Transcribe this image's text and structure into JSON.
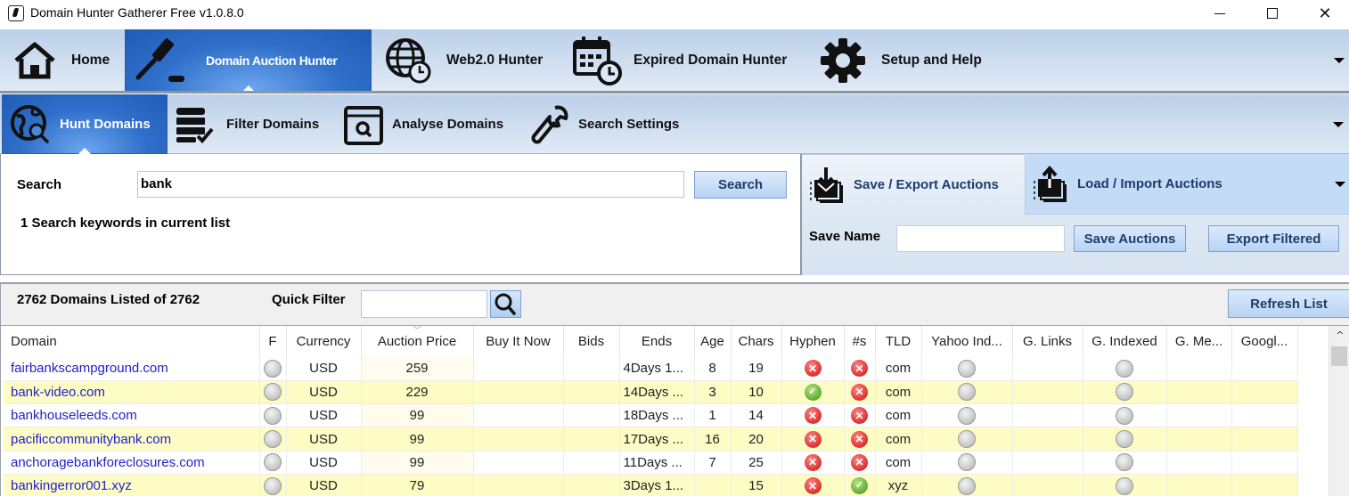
{
  "window": {
    "title": "Domain Hunter Gatherer Free v1.0.8.0",
    "controls": {
      "minimize": "—",
      "maximize": "☐",
      "close": "✕"
    }
  },
  "main_nav": {
    "items": [
      {
        "label": "Home",
        "icon": "home-icon",
        "active": false
      },
      {
        "label": "Domain Auction Hunter",
        "icon": "gavel-icon",
        "active": true
      },
      {
        "label": "Web2.0 Hunter",
        "icon": "globe-clock-icon",
        "active": false
      },
      {
        "label": "Expired Domain Hunter",
        "icon": "calendar-clock-icon",
        "active": false
      },
      {
        "label": "Setup and Help",
        "icon": "gear-icon",
        "active": false
      }
    ]
  },
  "sub_nav": {
    "items": [
      {
        "label": "Hunt Domains",
        "icon": "globe-search-icon",
        "active": true
      },
      {
        "label": "Filter Domains",
        "icon": "database-check-icon",
        "active": false
      },
      {
        "label": "Analyse Domains",
        "icon": "browser-search-icon",
        "active": false
      },
      {
        "label": "Search Settings",
        "icon": "wrench-icon",
        "active": false
      }
    ]
  },
  "search_panel": {
    "search_label": "Search",
    "search_value": "bank",
    "search_button": "Search",
    "keywords_status": "1 Search keywords in current list"
  },
  "export_panel": {
    "tabs": [
      {
        "label": "Save / Export Auctions",
        "icon": "download-stack-icon",
        "active": true
      },
      {
        "label": "Load / Import Auctions",
        "icon": "upload-stack-icon",
        "active": false
      }
    ],
    "save_name_label": "Save Name",
    "save_name_value": "",
    "save_button": "Save Auctions",
    "export_button": "Export Filtered"
  },
  "grid_toolbar": {
    "count_text": "2762 Domains Listed of 2762",
    "quick_filter_label": "Quick Filter",
    "quick_filter_value": "",
    "refresh_button": "Refresh List"
  },
  "table": {
    "sorted_column": "Auction Price",
    "columns": [
      "Domain",
      "F",
      "Currency",
      "Auction Price",
      "Buy It Now",
      "Bids",
      "Ends",
      "Age",
      "Chars",
      "Hyphen",
      "#s",
      "TLD",
      "Yahoo Ind...",
      "G. Links",
      "G. Indexed",
      "G. Me...",
      "Googl..."
    ],
    "rows": [
      {
        "domain": "fairbankscampground.com",
        "f": "unknown",
        "currency": "USD",
        "auction_price": "259",
        "buy_it_now": "",
        "bids": "",
        "ends": "4Days 1...",
        "age": "8",
        "chars": "19",
        "hyphen": "no",
        "numbers": "no",
        "tld": "com",
        "yahoo_indexed": "unknown",
        "g_links": "",
        "g_indexed": "unknown",
        "g_me": "",
        "googl": ""
      },
      {
        "domain": "bank-video.com",
        "f": "unknown",
        "currency": "USD",
        "auction_price": "229",
        "buy_it_now": "",
        "bids": "",
        "ends": "14Days ...",
        "age": "3",
        "chars": "10",
        "hyphen": "yes",
        "numbers": "no",
        "tld": "com",
        "yahoo_indexed": "unknown",
        "g_links": "",
        "g_indexed": "unknown",
        "g_me": "",
        "googl": ""
      },
      {
        "domain": "bankhouseleeds.com",
        "f": "unknown",
        "currency": "USD",
        "auction_price": "99",
        "buy_it_now": "",
        "bids": "",
        "ends": "18Days ...",
        "age": "1",
        "chars": "14",
        "hyphen": "no",
        "numbers": "no",
        "tld": "com",
        "yahoo_indexed": "unknown",
        "g_links": "",
        "g_indexed": "unknown",
        "g_me": "",
        "googl": ""
      },
      {
        "domain": "pacificcommunitybank.com",
        "f": "unknown",
        "currency": "USD",
        "auction_price": "99",
        "buy_it_now": "",
        "bids": "",
        "ends": "17Days ...",
        "age": "16",
        "chars": "20",
        "hyphen": "no",
        "numbers": "no",
        "tld": "com",
        "yahoo_indexed": "unknown",
        "g_links": "",
        "g_indexed": "unknown",
        "g_me": "",
        "googl": ""
      },
      {
        "domain": "anchoragebankforeclosures.com",
        "f": "unknown",
        "currency": "USD",
        "auction_price": "99",
        "buy_it_now": "",
        "bids": "",
        "ends": "11Days ...",
        "age": "7",
        "chars": "25",
        "hyphen": "no",
        "numbers": "no",
        "tld": "com",
        "yahoo_indexed": "unknown",
        "g_links": "",
        "g_indexed": "unknown",
        "g_me": "",
        "googl": ""
      },
      {
        "domain": "bankingerror001.xyz",
        "f": "unknown",
        "currency": "USD",
        "auction_price": "79",
        "buy_it_now": "",
        "bids": "",
        "ends": "3Days 1...",
        "age": "",
        "chars": "15",
        "hyphen": "no",
        "numbers": "yes",
        "tld": "xyz",
        "yahoo_indexed": "unknown",
        "g_links": "",
        "g_indexed": "unknown",
        "g_me": "",
        "googl": ""
      }
    ]
  },
  "colors": {
    "accent_blue": "#2f6fc9",
    "ribbon_top": "#bcd0e9",
    "ribbon_bottom": "#e0eaf6",
    "row_alt": "#fdfcc4",
    "domain_link": "#2222cc",
    "status_no": "#e13a3a",
    "status_yes": "#6ab43a"
  }
}
